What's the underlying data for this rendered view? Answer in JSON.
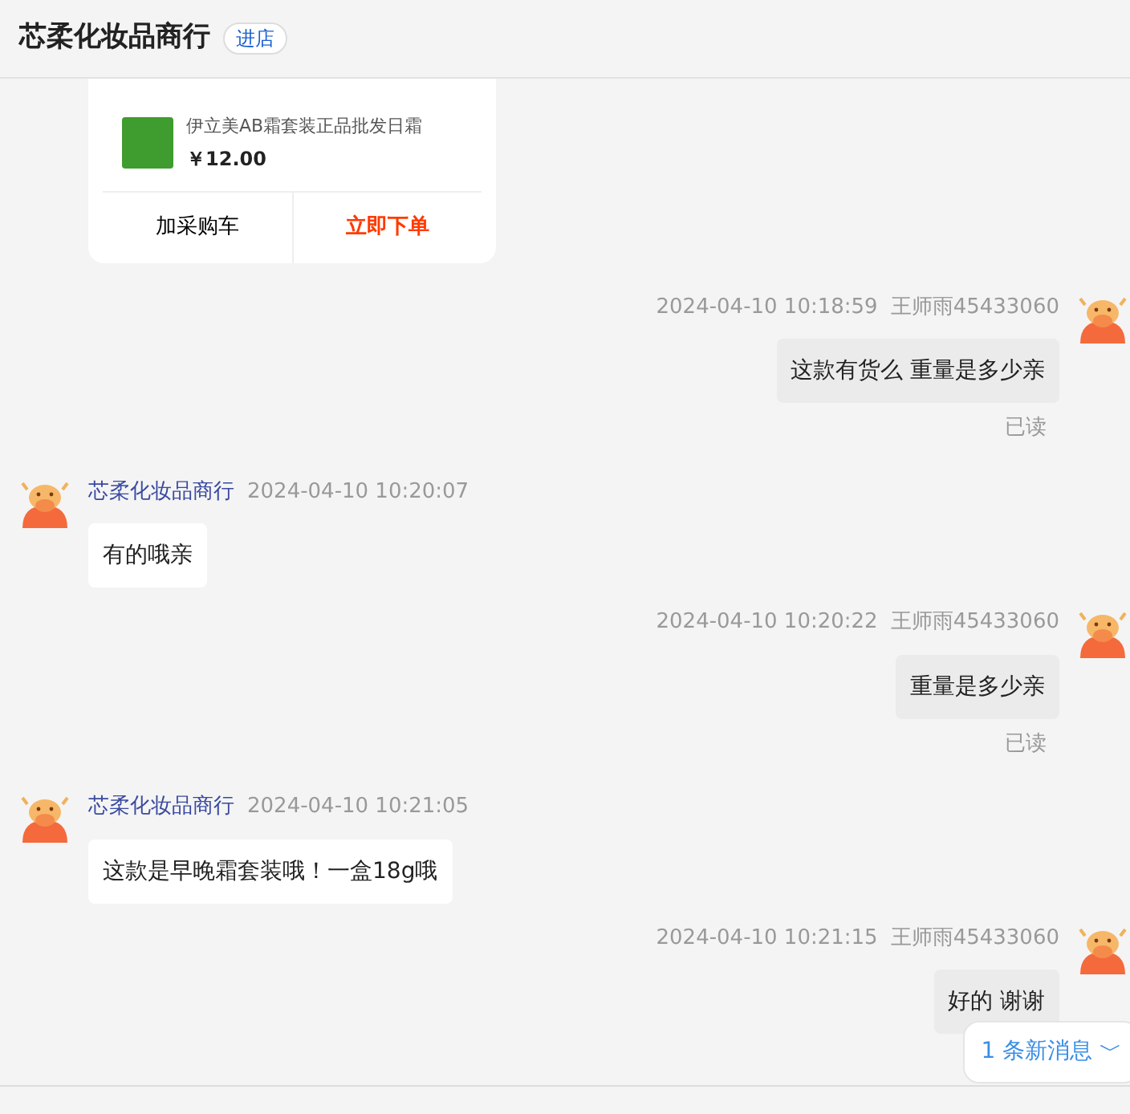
{
  "header": {
    "title": "芯柔化妆品商行",
    "shop_button": "进店"
  },
  "order_card": {
    "product": {
      "name": "伊立美AB霜套装正品批发日霜",
      "price": "￥12.00"
    },
    "buttons": [
      {
        "label": "加采购车",
        "kind": "plain"
      },
      {
        "label": "立即下单",
        "kind": "primary"
      }
    ]
  },
  "messages": [
    {
      "kind": "self",
      "time": "2024-04-10 10:18:59",
      "sender": "王师雨45433060",
      "text": "这款有货么 重量是多少亲",
      "status": "已读"
    },
    {
      "kind": "other",
      "time": "2024-04-10 10:20:07",
      "sender": "芯柔化妆品商行",
      "text": "有的哦亲"
    },
    {
      "kind": "self",
      "time": "2024-04-10 10:20:22",
      "sender": "王师雨45433060",
      "text": "重量是多少亲",
      "status": "已读"
    },
    {
      "kind": "other",
      "time": "2024-04-10 10:21:05",
      "sender": "芯柔化妆品商行",
      "text": "这款是早晚霜套装哦！一盒18g哦"
    },
    {
      "kind": "self",
      "time": "2024-04-10 10:21:15",
      "sender": "王师雨45433060",
      "text": "好的 谢谢"
    }
  ],
  "new_messages": {
    "label": "1 条新消息",
    "arrow": "﹀"
  }
}
